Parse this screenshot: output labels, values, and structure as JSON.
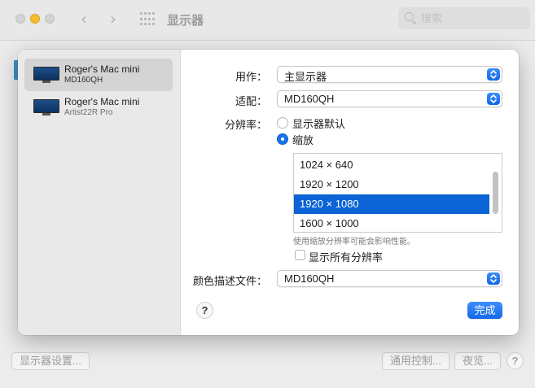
{
  "window": {
    "title": "显示器",
    "search_placeholder": "搜索"
  },
  "bottom_bar": {
    "display_settings_label": "显示器设置...",
    "universal_control_label": "通用控制...",
    "night_shift_label": "夜览...",
    "help_label": "?"
  },
  "sidebar": {
    "displays": [
      {
        "name": "Roger's Mac mini",
        "model": "MD160QH",
        "selected": true
      },
      {
        "name": "Roger's Mac mini",
        "model": "Artist22R Pro",
        "selected": false
      }
    ]
  },
  "settings": {
    "use_as_label": "用作：",
    "use_as_value": "主显示器",
    "optimize_for_label": "适配：",
    "optimize_for_value": "MD160QH",
    "resolution_label": "分辨率：",
    "resolution_options": [
      "显示器默认",
      "缩放"
    ],
    "resolution_selected": "缩放",
    "resolutions": [
      "1024 × 640",
      "1920 × 1200",
      "1920 × 1080",
      "1600 × 1000"
    ],
    "selected_resolution": "1920 × 1080",
    "hint": "使用缩放分辨率可能会影响性能。",
    "show_all_label": "显示所有分辨率",
    "show_all_checked": false,
    "color_profile_label": "颜色描述文件：",
    "color_profile_value": "MD160QH",
    "help_label": "?",
    "done_label": "完成"
  },
  "colors": {
    "accent": "#1a73e8",
    "selection": "#0c64d6",
    "minimize_light": "#f5bd2e"
  }
}
